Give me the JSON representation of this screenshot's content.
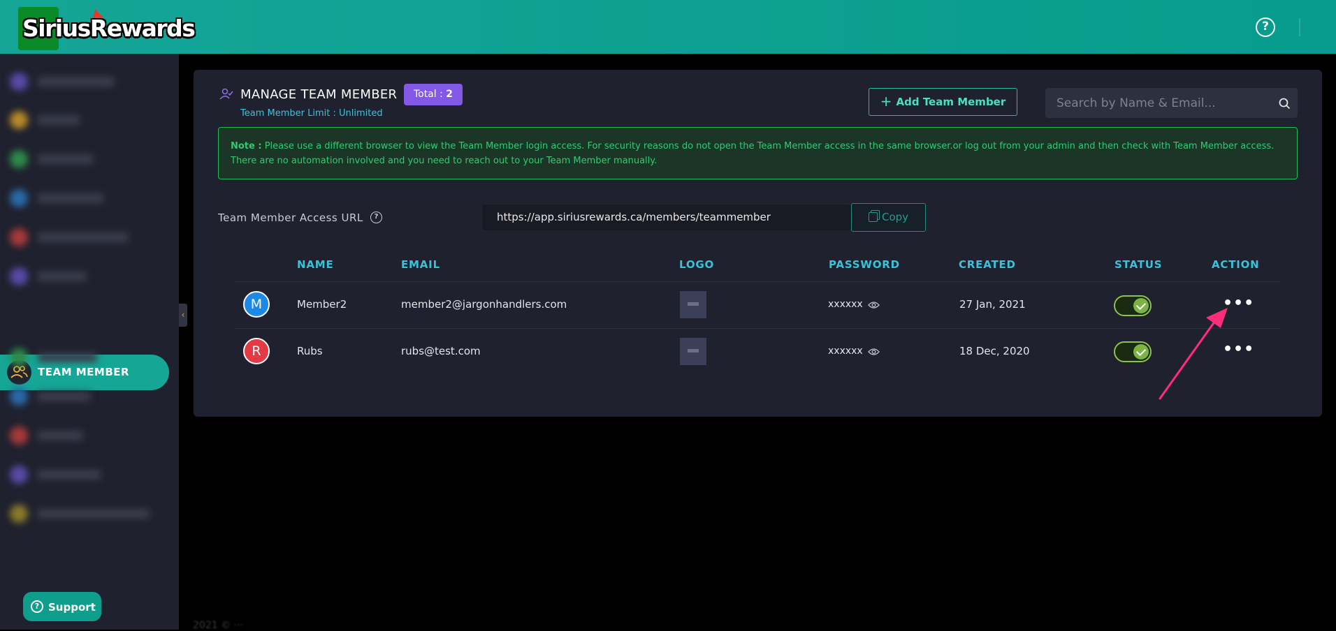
{
  "app": {
    "logo_text": "SiriusRewards",
    "help_icon": "question-circle-icon"
  },
  "sidebar": {
    "active_item": {
      "label": "TEAM MEMBER",
      "icon": "users-icon"
    },
    "support_label": "Support",
    "support_icon": "question-circle-icon"
  },
  "header": {
    "title": "MANAGE TEAM MEMBER",
    "total_label": "Total : ",
    "total_value": "2",
    "limit_text": "Team Member Limit : Unlimited",
    "add_button_label": "Add Team Member",
    "search_placeholder": "Search by Name & Email..."
  },
  "note": {
    "prefix": "Note :",
    "text": " Please use a different browser to view the Team Member login access. For security reasons do not open the Team Member access in the same browser.or log out from your admin and then check with Team Member access. There are no automation involved and you need to reach out to your Team Member manually."
  },
  "access_url": {
    "label": "Team Member Access URL",
    "value": "https://app.siriusrewards.ca/members/teammember",
    "copy_label": "Copy"
  },
  "table": {
    "headers": [
      "NAME",
      "EMAIL",
      "LOGO",
      "PASSWORD",
      "CREATED",
      "STATUS",
      "ACTION"
    ],
    "rows": [
      {
        "initial": "M",
        "avatar_color": "#1e88e5",
        "name": "Member2",
        "email": "member2@jargonhandlers.com",
        "password": "xxxxxx",
        "created": "27 Jan, 2021",
        "status": true,
        "action": "•••"
      },
      {
        "initial": "R",
        "avatar_color": "#e53945",
        "name": "Rubs",
        "email": "rubs@test.com",
        "password": "xxxxxx",
        "created": "18 Dec, 2020",
        "status": true,
        "action": "•••"
      }
    ]
  },
  "colors": {
    "topbar": "#0fa393",
    "accent_teal": "#39c3d8",
    "badge_purple": "#8358e6",
    "note_green": "#2ecc71",
    "annotation_arrow": "#ff2d7a"
  }
}
